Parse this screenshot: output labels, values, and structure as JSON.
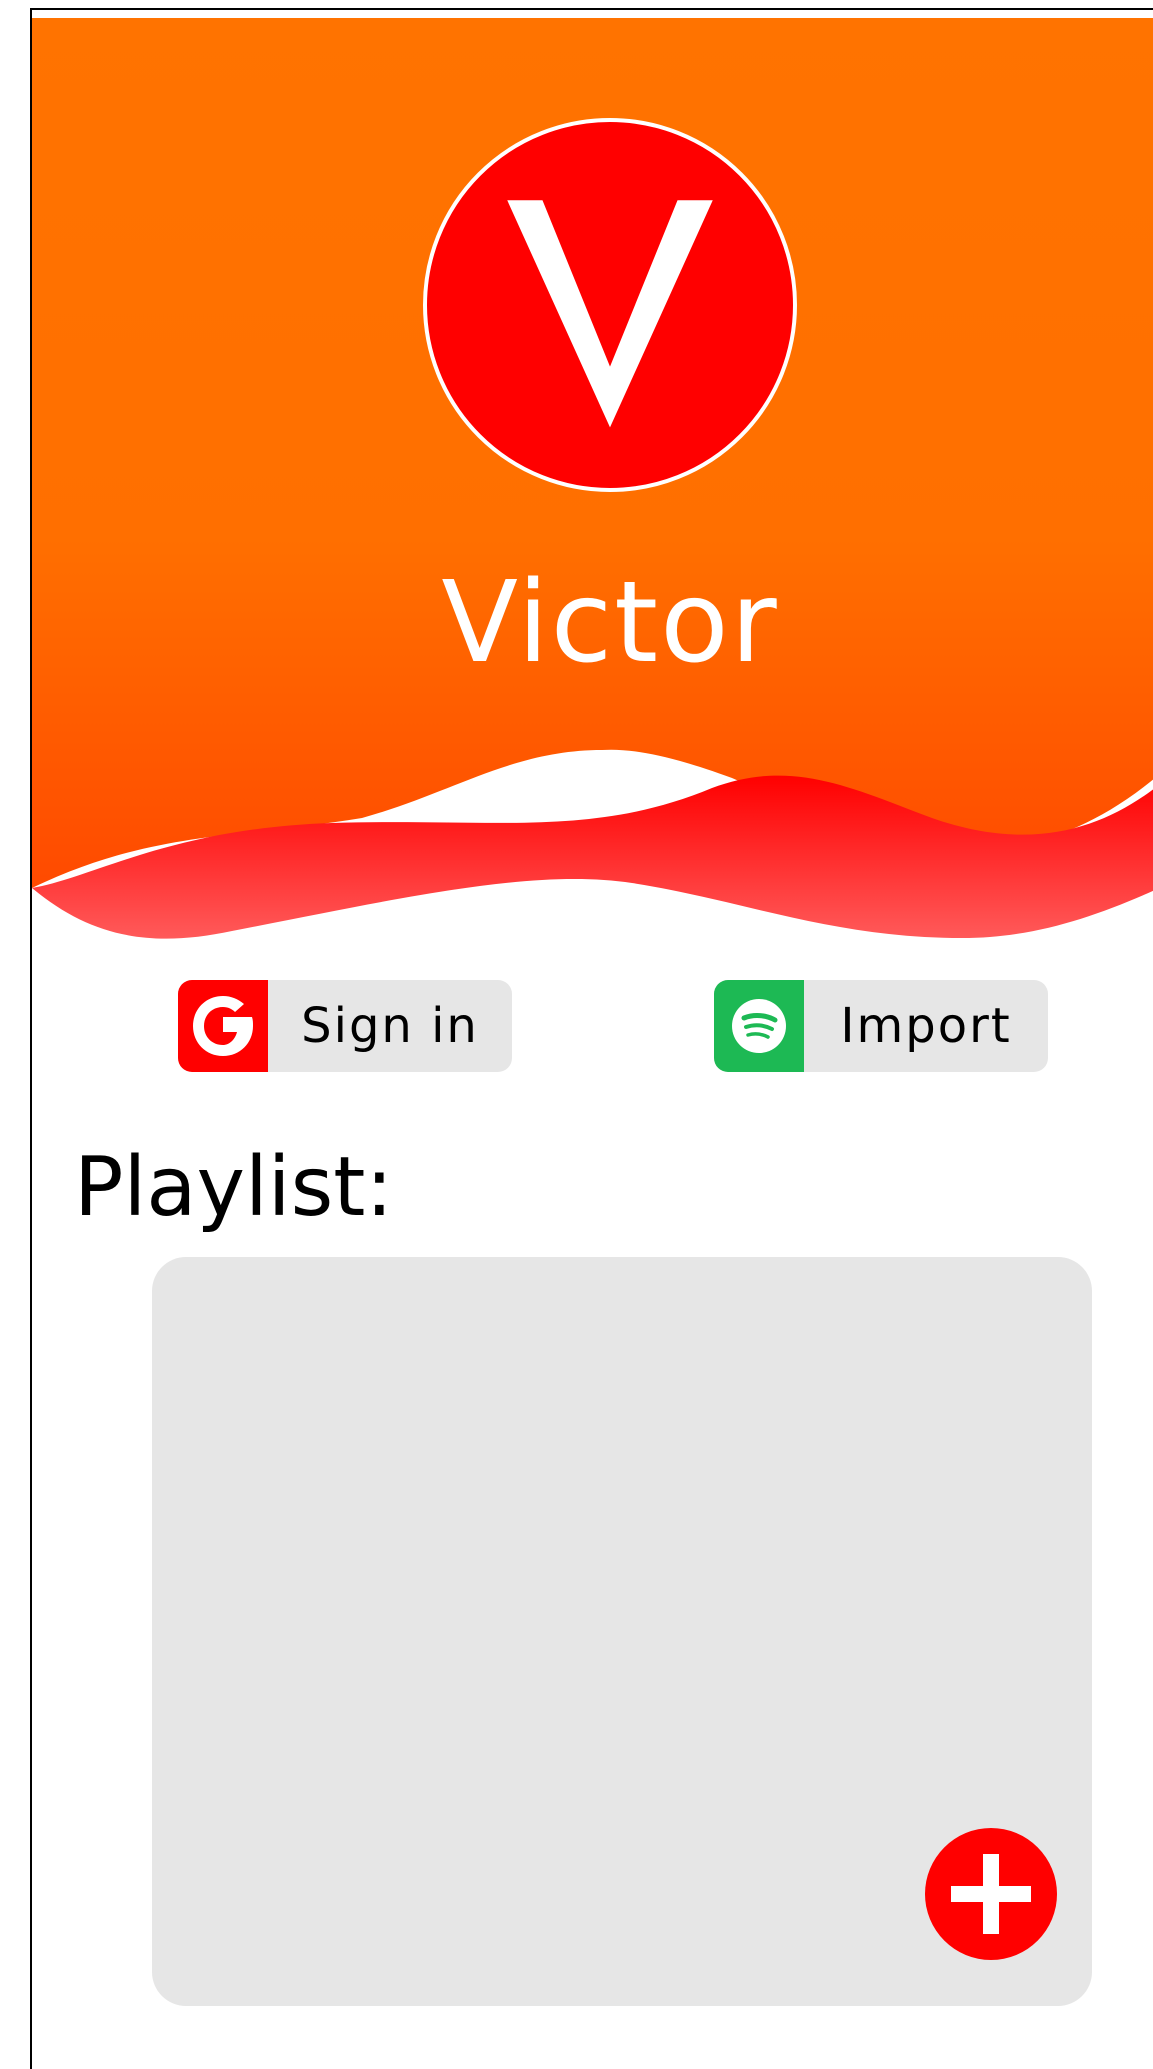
{
  "profile": {
    "initial": "V",
    "name": "Victor"
  },
  "buttons": {
    "signin_label": "Sign in",
    "signin_icon": "google-icon",
    "import_label": "Import",
    "import_icon": "spotify-icon"
  },
  "playlist": {
    "title": "Playlist:",
    "add_icon": "plus-icon"
  },
  "colors": {
    "header_top": "#ff7300",
    "header_bottom": "#ff5000",
    "wave": "#ff1a1a",
    "accent_red": "#ff0000",
    "spotify_green": "#1db954",
    "panel": "#e6e6e6"
  }
}
